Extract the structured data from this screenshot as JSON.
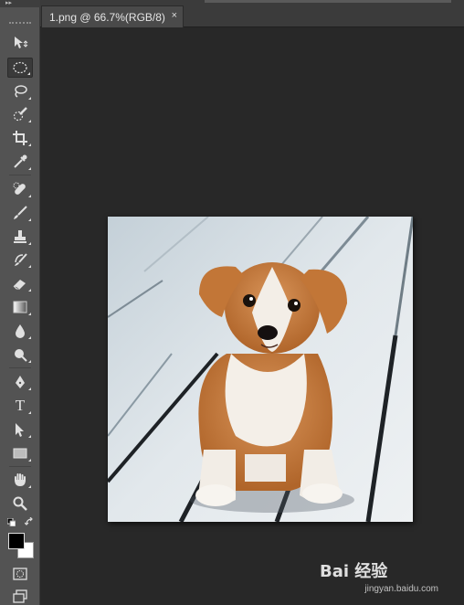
{
  "document_tab": {
    "title": "1.png @ 66.7%(RGB/8)",
    "close_glyph": "×"
  },
  "toolbar": {
    "collapse_glyph": "▸▸",
    "tools": [
      {
        "name": "move-tool",
        "icon": "move-icon"
      },
      {
        "name": "elliptical-marquee-tool",
        "icon": "ellipse-marquee-icon",
        "active": true
      },
      {
        "name": "lasso-tool",
        "icon": "lasso-icon"
      },
      {
        "name": "quick-selection-tool",
        "icon": "quick-selection-icon"
      },
      {
        "name": "crop-tool",
        "icon": "crop-icon"
      },
      {
        "name": "eyedropper-tool",
        "icon": "eyedropper-icon"
      },
      {
        "name": "spot-healing-tool",
        "icon": "bandage-icon"
      },
      {
        "name": "brush-tool",
        "icon": "brush-icon"
      },
      {
        "name": "clone-stamp-tool",
        "icon": "stamp-icon"
      },
      {
        "name": "history-brush-tool",
        "icon": "history-brush-icon"
      },
      {
        "name": "eraser-tool",
        "icon": "eraser-icon"
      },
      {
        "name": "gradient-tool",
        "icon": "gradient-icon"
      },
      {
        "name": "blur-tool",
        "icon": "drop-icon"
      },
      {
        "name": "dodge-tool",
        "icon": "dodge-icon"
      },
      {
        "name": "pen-tool",
        "icon": "pen-icon"
      },
      {
        "name": "type-tool",
        "icon": "type-icon",
        "glyph": "T"
      },
      {
        "name": "path-selection-tool",
        "icon": "path-selection-icon"
      },
      {
        "name": "rectangle-tool",
        "icon": "rectangle-icon"
      },
      {
        "name": "hand-tool",
        "icon": "hand-icon"
      },
      {
        "name": "zoom-tool",
        "icon": "zoom-icon"
      }
    ],
    "foreground_color": "#000000",
    "background_color": "#ffffff"
  },
  "colors": {
    "workspace": "#282828",
    "panel": "#535353",
    "tab_active": "#4a4a4a"
  },
  "watermark": {
    "text": "Bai 经验",
    "sub": "jingyan.baidu.com"
  }
}
